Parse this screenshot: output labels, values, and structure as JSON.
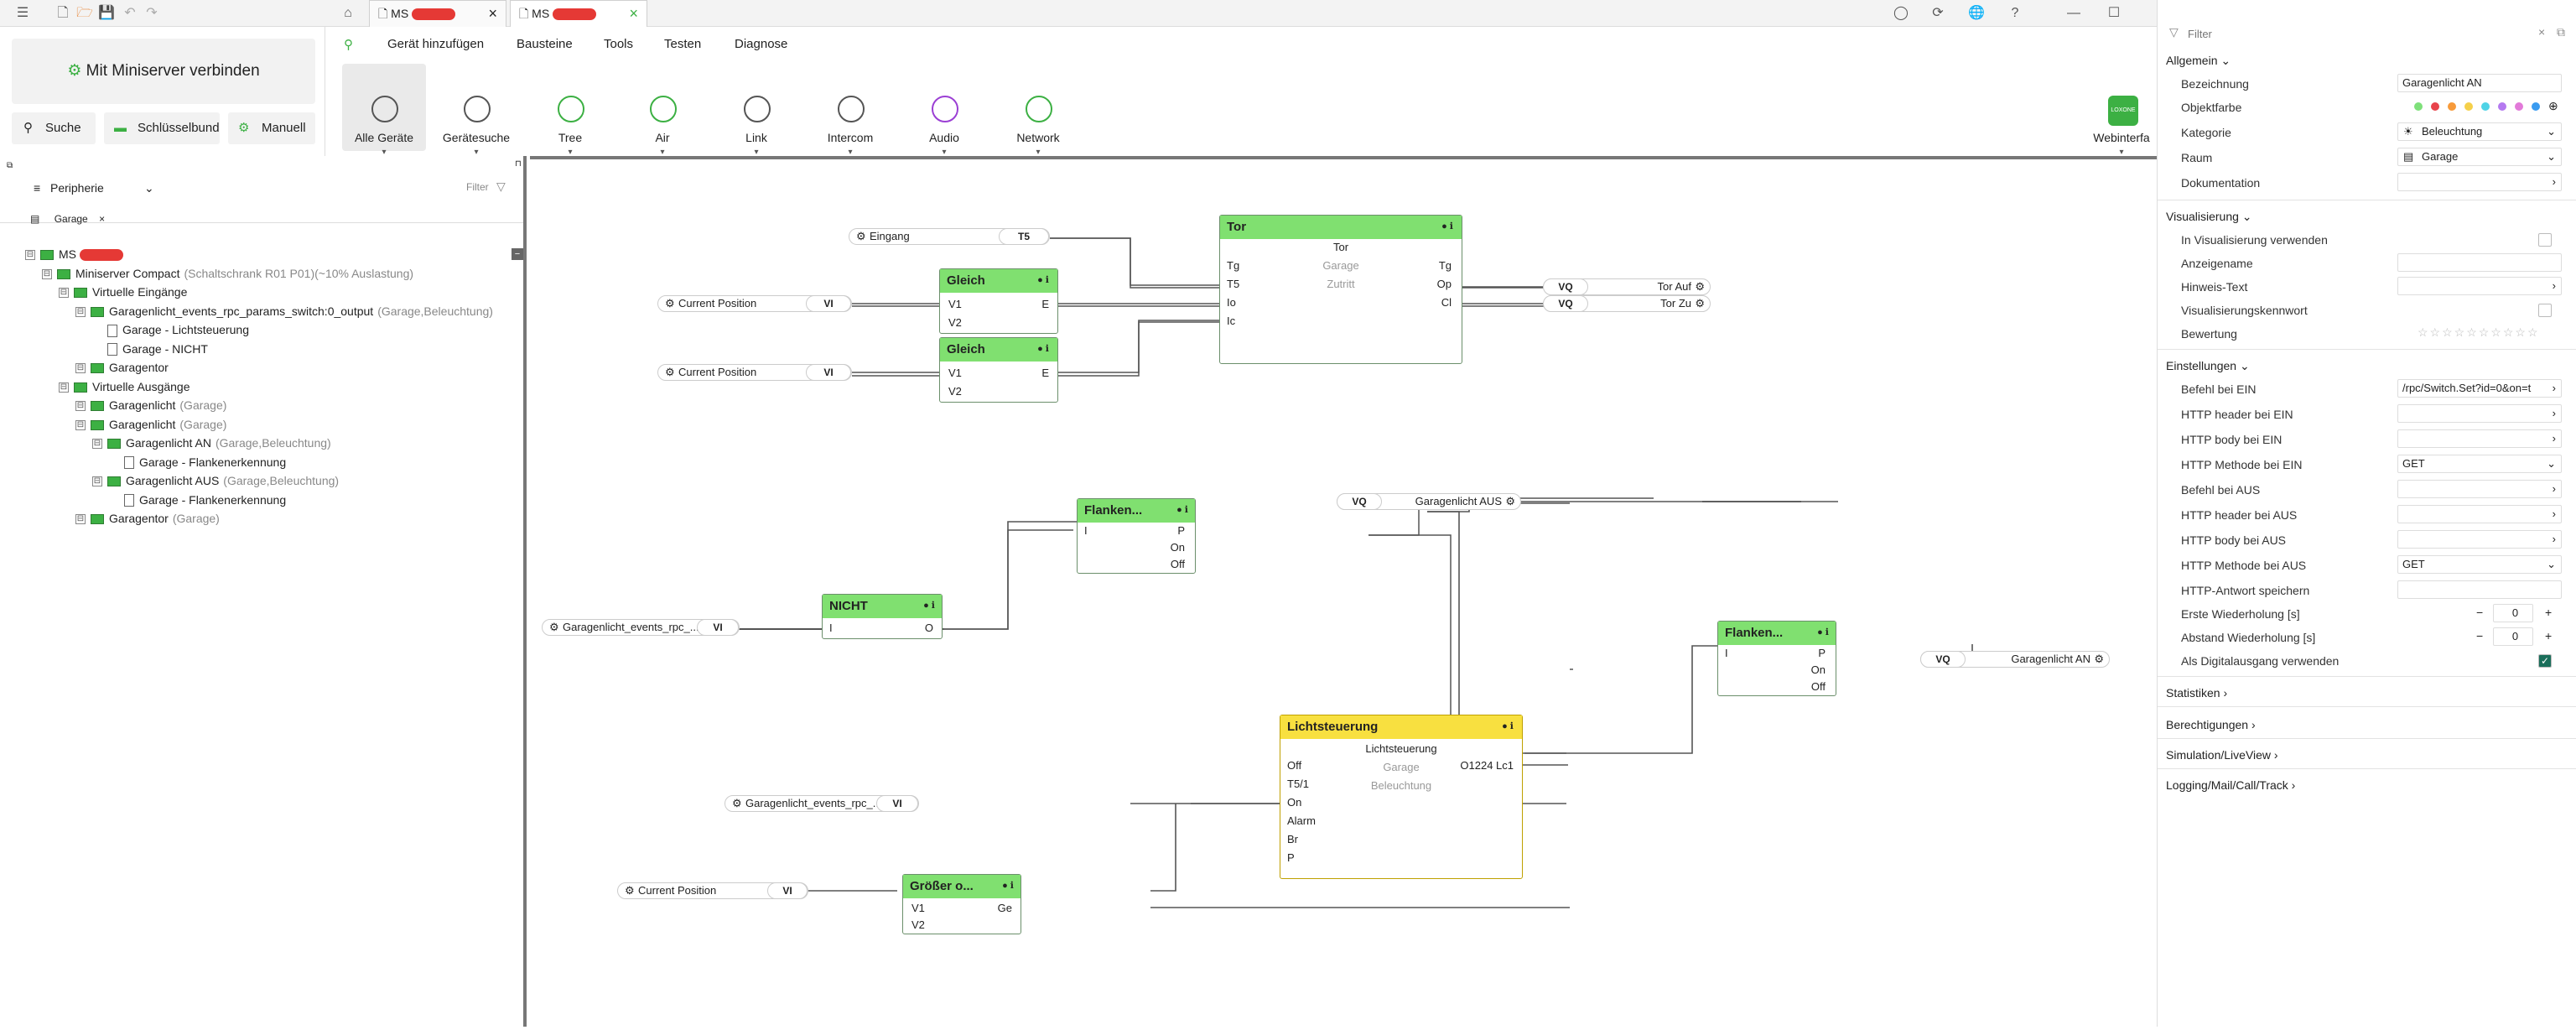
{
  "titlebar": {
    "tab1": "MS",
    "tab2": "MS"
  },
  "left": {
    "connect": "Mit Miniserver verbinden",
    "search": "Suche",
    "keychain": "Schlüsselbund",
    "manual": "Manuell"
  },
  "menu": [
    "Gerät hinzufügen",
    "Bausteine",
    "Tools",
    "Testen",
    "Diagnose"
  ],
  "ribbon": [
    {
      "label": "Alle Geräte",
      "color": "#555555"
    },
    {
      "label": "Gerätesuche",
      "color": "#555555"
    },
    {
      "label": "Tree",
      "color": "#3cb043"
    },
    {
      "label": "Air",
      "color": "#3cb043"
    },
    {
      "label": "Link",
      "color": "#555555"
    },
    {
      "label": "Intercom",
      "color": "#555555"
    },
    {
      "label": "Audio",
      "color": "#9b3fd4"
    },
    {
      "label": "Network",
      "color": "#3cb043"
    }
  ],
  "webinterface": {
    "logo": "LOXONE",
    "label": "Webinterfa"
  },
  "periphery": {
    "title": "Peripherie",
    "filter": "Filter",
    "chip": "Garage"
  },
  "tree": [
    {
      "t": "MS",
      "s": ""
    },
    {
      "t": "Miniserver Compact",
      "s": "(Schaltschrank R01 P01)(~10% Auslastung)"
    },
    {
      "t": "Virtuelle Eingänge",
      "s": ""
    },
    {
      "t": "Garagenlicht_events_rpc_params_switch:0_output",
      "s": "(Garage,Beleuchtung)"
    },
    {
      "t": "Garage - Lichtsteuerung",
      "s": ""
    },
    {
      "t": "Garage - NICHT",
      "s": ""
    },
    {
      "t": "Garagentor",
      "s": ""
    },
    {
      "t": "Virtuelle Ausgänge",
      "s": ""
    },
    {
      "t": "Garagenlicht",
      "s": "(Garage)"
    },
    {
      "t": "Garagenlicht",
      "s": "(Garage)"
    },
    {
      "t": "Garagenlicht AN",
      "s": "(Garage,Beleuchtung)"
    },
    {
      "t": "Garage - Flankenerkennung",
      "s": ""
    },
    {
      "t": "Garagenlicht AUS",
      "s": "(Garage,Beleuchtung)"
    },
    {
      "t": "Garage - Flankenerkennung",
      "s": ""
    },
    {
      "t": "Garagentor",
      "s": "(Garage)"
    }
  ],
  "canvas": {
    "eingang": "Eingang",
    "t5": "T5",
    "cp": "Current Position",
    "vi": "VI",
    "vq": "VQ",
    "gleich": "Gleich",
    "v1": "V1",
    "v2": "V2",
    "e": "E",
    "tor": {
      "title": "Tor",
      "sub": "Tor",
      "room": "Garage",
      "cat": "Zutritt",
      "in": [
        "Tg",
        "T5",
        "Io",
        "Ic"
      ],
      "out": [
        "Tg",
        "Op",
        "Cl"
      ]
    },
    "torauf": "Tor Auf",
    "torzu": "Tor Zu",
    "flanken": "Flanken...",
    "flp": "P",
    "flon": "On",
    "floff": "Off",
    "fli": "I",
    "glaus": "Garagenlicht AUS",
    "glan": "Garagenlicht AN",
    "nicht": "NICHT",
    "ni": "I",
    "no": "O",
    "events": "Garagenlicht_events_rpc_...",
    "licht": {
      "title": "Lichtsteuerung",
      "sub": "Lichtsteuerung",
      "room": "Garage",
      "cat": "Beleuchtung",
      "in": [
        "Off",
        "T5/1",
        "On",
        "Alarm",
        "Br",
        "P"
      ],
      "out": "O1224 Lc1"
    },
    "groesser": "Größer o...",
    "ge": "Ge"
  },
  "props": {
    "filter": "Filter",
    "allgemein": "Allgemein",
    "bezeichnung": "Bezeichnung",
    "bezeichnung_v": "Garagenlicht AN",
    "objektfarbe": "Objektfarbe",
    "kategorie": "Kategorie",
    "kategorie_v": "Beleuchtung",
    "raum": "Raum",
    "raum_v": "Garage",
    "dokumentation": "Dokumentation",
    "visualisierung": "Visualisierung",
    "invis": "In Visualisierung verwenden",
    "anzeige": "Anzeigename",
    "hinweis": "Hinweis-Text",
    "viskw": "Visualisierungskennwort",
    "bewertung": "Bewertung",
    "einstellungen": "Einstellungen",
    "befehl_ein": "Befehl bei EIN",
    "befehl_ein_v": "/rpc/Switch.Set?id=0&on=t",
    "hh_ein": "HTTP header bei EIN",
    "hb_ein": "HTTP body bei EIN",
    "hm_ein": "HTTP Methode bei EIN",
    "hm_ein_v": "GET",
    "befehl_aus": "Befehl bei AUS",
    "hh_aus": "HTTP header bei AUS",
    "hb_aus": "HTTP body bei AUS",
    "hm_aus": "HTTP Methode bei AUS",
    "hm_aus_v": "GET",
    "antwort": "HTTP-Antwort speichern",
    "erste": "Erste Wiederholung [s]",
    "erste_v": "0",
    "abstand": "Abstand Wiederholung [s]",
    "abstand_v": "0",
    "digital": "Als Digitalausgang verwenden",
    "statistiken": "Statistiken",
    "berechtigungen": "Berechtigungen",
    "simulation": "Simulation/LiveView",
    "logging": "Logging/Mail/Call/Track"
  }
}
